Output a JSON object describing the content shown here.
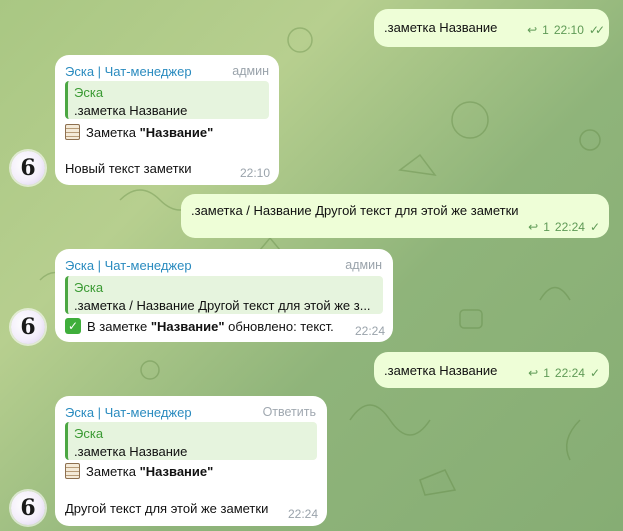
{
  "messages": [
    {
      "id": "m1",
      "kind": "outgoing",
      "text": ".заметка Название",
      "replies": "1",
      "time": "22:10",
      "status": "read"
    },
    {
      "id": "m2",
      "kind": "incoming",
      "sender": "Эска | Чат-менеджер",
      "role": "админ",
      "quote": {
        "name": "Эска",
        "text": ".заметка Название"
      },
      "line1": "Заметка \"Название\"",
      "line2": "Новый текст заметки",
      "time": "22:10"
    },
    {
      "id": "m3",
      "kind": "outgoing",
      "text": ".заметка / Название Другой текст для этой же заметки",
      "replies": "1",
      "time": "22:24",
      "status": "sent"
    },
    {
      "id": "m4",
      "kind": "incoming",
      "sender": "Эска | Чат-менеджер",
      "role": "админ",
      "quote": {
        "name": "Эска",
        "text": ".заметка / Название Другой текст для этой же з..."
      },
      "line1": "В заметке \"Название\" обновлено: текст.",
      "time": "22:24"
    },
    {
      "id": "m5",
      "kind": "outgoing",
      "text": ".заметка Название",
      "replies": "1",
      "time": "22:24",
      "status": "sent"
    },
    {
      "id": "m6",
      "kind": "incoming",
      "sender": "Эска | Чат-менеджер",
      "role": "Ответить",
      "quote": {
        "name": "Эска",
        "text": ".заметка Название"
      },
      "line1": "Заметка \"Название\"",
      "line2": "Другой текст для этой же заметки",
      "time": "22:24"
    }
  ],
  "avatar_letter": "6",
  "colors": {
    "outgoing_bubble": "#eefed7",
    "incoming_bubble": "#ffffff",
    "accent_name": "#2a8bbf",
    "quote_bar": "#4ca743"
  }
}
